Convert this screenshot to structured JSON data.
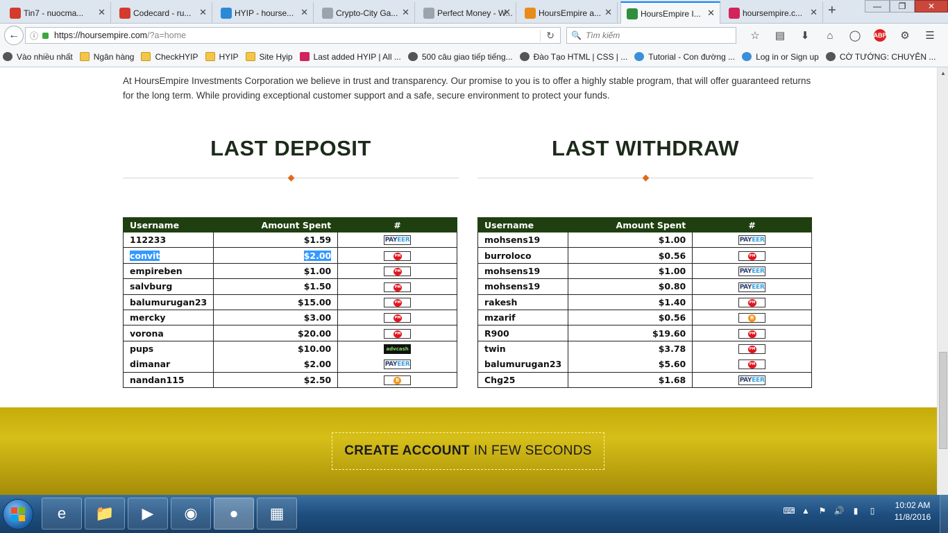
{
  "tabs": [
    {
      "label": "Tin7 - nuocma...",
      "icon": "gmail-icon",
      "color": "#d33b2c"
    },
    {
      "label": "Codecard - ru...",
      "icon": "gmail-icon",
      "color": "#d33b2c"
    },
    {
      "label": "HYIP - hourse...",
      "icon": "skype-icon",
      "color": "#2a8ad6"
    },
    {
      "label": "Crypto-City Ga...",
      "icon": "page-icon",
      "color": "#9aa4ad"
    },
    {
      "label": "Perfect Money - W...",
      "icon": "page-icon",
      "color": "#9aa4ad"
    },
    {
      "label": "HoursEmpire a...",
      "icon": "dollar-icon",
      "color": "#e88b1a"
    },
    {
      "label": "HoursEmpire I...",
      "icon": "he-icon",
      "color": "#2f8f3d"
    },
    {
      "label": "hoursempire.c...",
      "icon": "a-icon",
      "color": "#d2235a"
    }
  ],
  "url": {
    "host": "https://hoursempire.com",
    "path": "/?a=home"
  },
  "search": {
    "placeholder": "Tìm kiếm"
  },
  "bookmarks": [
    {
      "label": "Vào nhiều nhất",
      "icon": "gear-icon"
    },
    {
      "label": "Ngân hàng",
      "icon": "folder-icon"
    },
    {
      "label": "CheckHYIP",
      "icon": "folder-icon"
    },
    {
      "label": "HYIP",
      "icon": "folder-icon"
    },
    {
      "label": "Site Hyip",
      "icon": "folder-icon"
    },
    {
      "label": "Last added HYIP | All ...",
      "icon": "a-icon"
    },
    {
      "label": "500 câu giao tiếp tiếng...",
      "icon": "globe-icon"
    },
    {
      "label": "Đào Tạo HTML | CSS | ...",
      "icon": "globe-icon"
    },
    {
      "label": "Tutorial - Con đường ...",
      "icon": "skype-icon"
    },
    {
      "label": "Log in or Sign up",
      "icon": "skype-icon"
    },
    {
      "label": "CỜ TƯỚNG: CHUYÊN ...",
      "icon": "globe-icon"
    }
  ],
  "intro": "At HoursEmpire Investments Corporation we believe in trust and transparency. Our promise to you is to offer a highly stable program, that will offer guaranteed returns for the long term. While providing exceptional customer support and a safe, secure environment to protect your funds.",
  "deposit": {
    "title": "LAST DEPOSIT",
    "headers": {
      "user": "Username",
      "amount": "Amount Spent",
      "pay": "#"
    },
    "rows": [
      {
        "user": "112233",
        "amount": "$1.59",
        "pay": "payeer"
      },
      {
        "user": "convit",
        "amount": "$2.00",
        "pay": "pm"
      },
      {
        "user": "empireben",
        "amount": "$1.00",
        "pay": "pm"
      },
      {
        "user": "salvburg",
        "amount": "$1.50",
        "pay": "pm"
      },
      {
        "user": "balumurugan23",
        "amount": "$15.00",
        "pay": "pm"
      },
      {
        "user": "mercky",
        "amount": "$3.00",
        "pay": "pm"
      },
      {
        "user": "vorona",
        "amount": "$20.00",
        "pay": "pm"
      },
      {
        "user": "pups",
        "amount": "$10.00",
        "pay": "advcash"
      },
      {
        "user": "dimanar",
        "amount": "$2.00",
        "pay": "payeer"
      },
      {
        "user": "nandan115",
        "amount": "$2.50",
        "pay": "bitcoin"
      }
    ]
  },
  "withdraw": {
    "title": "LAST WITHDRAW",
    "headers": {
      "user": "Username",
      "amount": "Amount Spent",
      "pay": "#"
    },
    "rows": [
      {
        "user": "mohsens19",
        "amount": "$1.00",
        "pay": "payeer"
      },
      {
        "user": "burroloco",
        "amount": "$0.56",
        "pay": "pm"
      },
      {
        "user": "mohsens19",
        "amount": "$1.00",
        "pay": "payeer"
      },
      {
        "user": "mohsens19",
        "amount": "$0.80",
        "pay": "payeer"
      },
      {
        "user": "rakesh",
        "amount": "$1.40",
        "pay": "pm"
      },
      {
        "user": "mzarif",
        "amount": "$0.56",
        "pay": "bitcoin"
      },
      {
        "user": "R900",
        "amount": "$19.60",
        "pay": "pm"
      },
      {
        "user": "twin",
        "amount": "$3.78",
        "pay": "pm"
      },
      {
        "user": "balumurugan23",
        "amount": "$5.60",
        "pay": "pm"
      },
      {
        "user": "Chg25",
        "amount": "$1.68",
        "pay": "payeer"
      }
    ]
  },
  "banner": {
    "bold": "CREATE ACCOUNT",
    "rest": "IN FEW SECONDS"
  },
  "clock": {
    "time": "10:02 AM",
    "date": "11/8/2016"
  },
  "colors": {
    "table_header": "#1f3f10",
    "accent": "#e06a1a",
    "banner": "#c6ab0a",
    "selection": "#3399ff"
  }
}
